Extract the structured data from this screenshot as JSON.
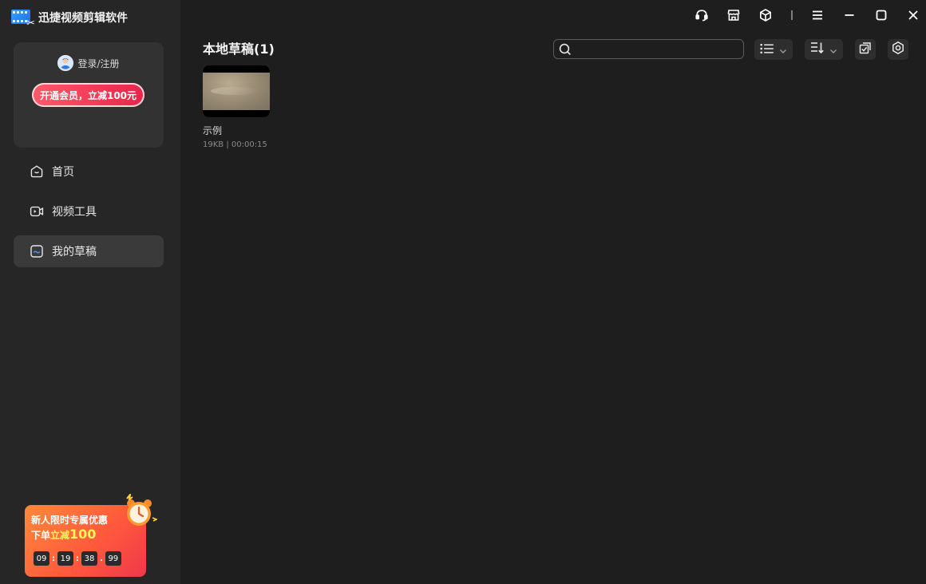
{
  "app": {
    "name": "迅捷视频剪辑软件"
  },
  "account": {
    "login_label": "登录/注册",
    "vip_button": "开通会员，立减100元"
  },
  "nav": {
    "items": [
      {
        "label": "首页",
        "icon": "home-icon",
        "active": false
      },
      {
        "label": "视频工具",
        "icon": "video-camera-icon",
        "active": false
      },
      {
        "label": "我的草稿",
        "icon": "draft-icon",
        "active": true
      }
    ]
  },
  "promo": {
    "line1": "新人限时专属优惠",
    "line2_prefix": "下单",
    "line2_highlight": "立减",
    "line2_amount": "100",
    "timer": [
      "09",
      "19",
      "38",
      "99"
    ]
  },
  "topbar": {
    "icons": [
      "headset-icon",
      "store-icon",
      "cube-icon",
      "menu-icon",
      "minimize-icon",
      "maximize-icon",
      "close-icon"
    ]
  },
  "main": {
    "title": "本地草稿(1)",
    "search": {
      "placeholder": ""
    },
    "drafts": [
      {
        "name": "示例",
        "meta": "19KB | 00:00:15"
      }
    ]
  },
  "colors": {
    "bg": "#1e1e1e",
    "sidebar": "#262626",
    "accent_red": "#e8244a",
    "promo_orange": "#ff8a3a"
  }
}
